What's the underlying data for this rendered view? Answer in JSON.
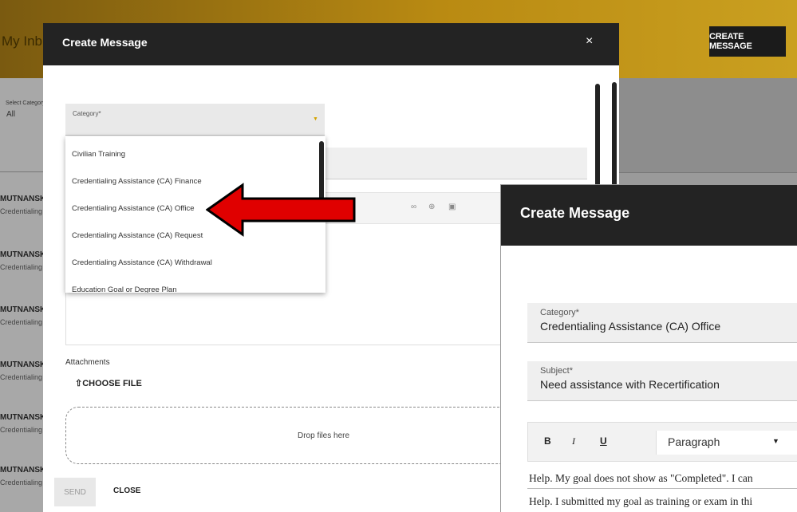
{
  "background": {
    "inbox_title": "My Inb",
    "create_message_button": "CREATE MESSAGE",
    "filter_label": "Select Category",
    "filter_value": "All",
    "list_rows": [
      {
        "name": "MUTNANSKY,",
        "category": "Credentialing As"
      },
      {
        "name": "MUTNANSKY,",
        "category": "Credentialing As"
      },
      {
        "name": "MUTNANSKY,",
        "category": "Credentialing As"
      },
      {
        "name": "MUTNANSKY,",
        "category": "Credentialing As"
      },
      {
        "name": "MUTNANSKY,",
        "category": "Credentialing As"
      },
      {
        "name": "MUTNANSKY,",
        "category": "Credentialing As"
      }
    ]
  },
  "modal": {
    "title": "Create Message",
    "close_icon": "×",
    "category_label": "Category*",
    "dropdown_options": [
      "Civilian Training",
      "Credentialing Assistance (CA) Finance",
      "Credentialing Assistance (CA) Office",
      "Credentialing Assistance (CA) Request",
      "Credentialing Assistance (CA) Withdrawal",
      "Education Goal or Degree Plan"
    ],
    "attachments_label": "Attachments",
    "choose_file_label": "CHOOSE FILE",
    "drop_label": "Drop files here",
    "send_label": "SEND",
    "close_label": "CLOSE"
  },
  "zoom": {
    "title": "Create Message",
    "category_label": "Category*",
    "category_value": "Credentialing Assistance (CA) Office",
    "subject_label": "Subject*",
    "subject_value": "Need assistance with Recertification",
    "toolbar": {
      "bold": "B",
      "italic": "I",
      "underline": "U",
      "paragraph": "Paragraph"
    },
    "body_lines": [
      "Help. My goal does not show as \"Completed\". I can",
      "Help.  I submitted my goal as training or exam in thi"
    ]
  },
  "colors": {
    "header": "#232323",
    "accent": "#d4a300",
    "arrow": "#e00000"
  }
}
